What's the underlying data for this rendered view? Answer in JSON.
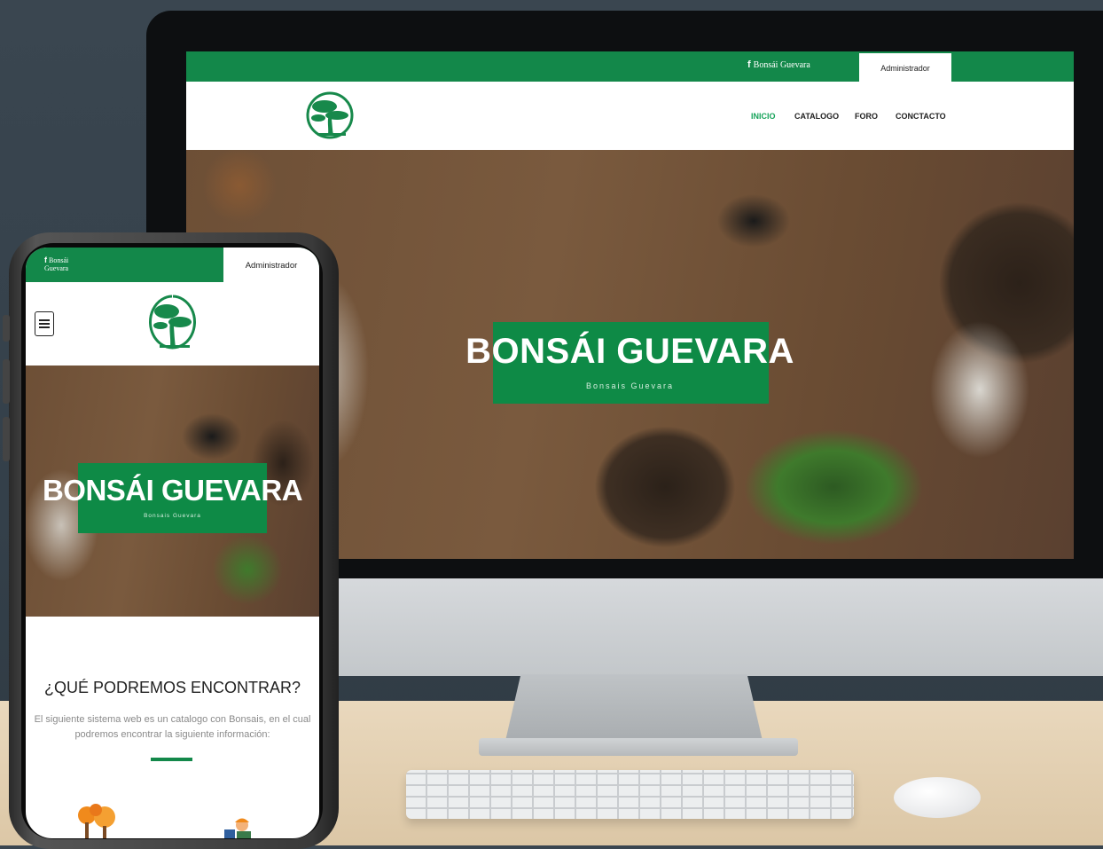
{
  "desktop": {
    "topbar": {
      "facebook_glyph": "f",
      "facebook_label": "Bonsái Guevara",
      "admin_label": "Administrador",
      "color": "#13884a"
    },
    "nav": {
      "items": [
        {
          "label": "INICIO",
          "active": true
        },
        {
          "label": "CATALOGO",
          "active": false
        },
        {
          "label": "FORO",
          "active": false
        },
        {
          "label": "CONCTACTO",
          "active": false
        }
      ],
      "active_color": "#17a35a"
    },
    "hero": {
      "title": "BONSÁI GUEVARA",
      "subtitle": "Bonsais Guevara",
      "box_color": "#0e8a46"
    }
  },
  "mobile": {
    "topbar": {
      "facebook_glyph": "f",
      "facebook_label_line1": "Bonsái",
      "facebook_label_line2": "Guevara",
      "admin_label": "Administrador"
    },
    "menu_icon": "hamburger-icon",
    "hero": {
      "title": "BONSÁI GUEVARA",
      "subtitle": "Bonsais Guevara"
    },
    "section": {
      "title": "¿QUÉ PODREMOS ENCONTRAR?",
      "text": "El siguiente sistema web es un catalogo con Bonsais, en el cual podremos encontrar la siguiente información:",
      "divider_color": "#13884a"
    },
    "icons": [
      "autumn-trees-icon",
      "worker-icon"
    ]
  }
}
